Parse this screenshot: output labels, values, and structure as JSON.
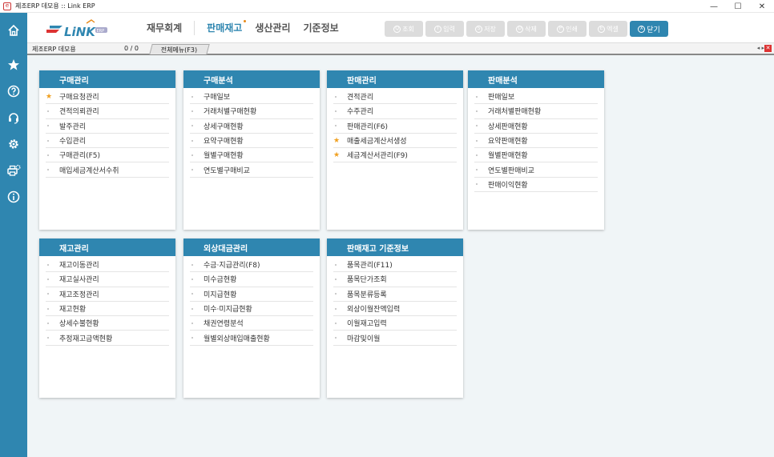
{
  "window": {
    "title": "제조ERP 데모용 :: Link ERP",
    "controls": [
      "—",
      "☐",
      "✕"
    ]
  },
  "logo": {
    "text": "LiNK",
    "badge": "ERP"
  },
  "topnav": [
    {
      "label": "재무회계",
      "active": false
    },
    {
      "label": "판매재고",
      "active": true
    },
    {
      "label": "생산관리",
      "active": false
    },
    {
      "label": "기준정보",
      "active": false
    }
  ],
  "actions": [
    {
      "icon": "Q",
      "label": "조회"
    },
    {
      "icon": "I",
      "label": "입력"
    },
    {
      "icon": "S",
      "label": "저장"
    },
    {
      "icon": "D",
      "label": "삭제"
    },
    {
      "icon": "P",
      "label": "인쇄"
    },
    {
      "icon": "E",
      "label": "엑셀"
    },
    {
      "icon": "X",
      "label": "닫기"
    }
  ],
  "tabrow": {
    "label": "제조ERP 데모용",
    "count": "0 / 0",
    "tab": "전체메뉴(F3)",
    "arrows": "◂ ▸",
    "close": "✕"
  },
  "sidebar": [
    "home-icon",
    "star-icon",
    "help-icon",
    "headset-icon",
    "gear-icon",
    "printer-settings-icon",
    "info-icon"
  ],
  "cards": [
    {
      "title": "구매관리",
      "items": [
        {
          "label": "구매요청관리",
          "fav": true
        },
        {
          "label": "견적의뢰관리"
        },
        {
          "label": "발주관리"
        },
        {
          "label": "수입관리"
        },
        {
          "label": "구매관리(F5)"
        },
        {
          "label": "매입세금계산서수취"
        }
      ]
    },
    {
      "title": "구매분석",
      "items": [
        {
          "label": "구매일보"
        },
        {
          "label": "거래처별구매현황"
        },
        {
          "label": "상세구매현황"
        },
        {
          "label": "요약구매현황"
        },
        {
          "label": "월별구매현황"
        },
        {
          "label": "연도별구매비교"
        }
      ]
    },
    {
      "title": "판매관리",
      "items": [
        {
          "label": "견적관리"
        },
        {
          "label": "수주관리"
        },
        {
          "label": "판매관리(F6)"
        },
        {
          "label": "매출세금계산서생성",
          "fav": true
        },
        {
          "label": "세금계산서관리(F9)",
          "fav": true
        }
      ]
    },
    {
      "title": "판매분석",
      "items": [
        {
          "label": "판매일보"
        },
        {
          "label": "거래처별판매현황"
        },
        {
          "label": "상세판매현황"
        },
        {
          "label": "요약판매현황"
        },
        {
          "label": "월별판매현황"
        },
        {
          "label": "연도별판매비교"
        },
        {
          "label": "판매이익현황"
        }
      ]
    },
    {
      "title": "재고관리",
      "items": [
        {
          "label": "재고이동관리"
        },
        {
          "label": "재고실사관리"
        },
        {
          "label": "재고조정관리"
        },
        {
          "label": "재고현황"
        },
        {
          "label": "상세수불현황"
        },
        {
          "label": "추정재고금액현황"
        }
      ]
    },
    {
      "title": "외상대금관리",
      "items": [
        {
          "label": "수금·지급관리(F8)"
        },
        {
          "label": "미수금현황"
        },
        {
          "label": "미지급현황"
        },
        {
          "label": "미수·미지급현황"
        },
        {
          "label": "채권연령분석"
        },
        {
          "label": "월별외상매입매출현황"
        }
      ]
    },
    {
      "title": "판매재고 기준정보",
      "items": [
        {
          "label": "품목관리(F11)"
        },
        {
          "label": "품목단가조회"
        },
        {
          "label": "품목분류등록"
        },
        {
          "label": "외상이월잔액입력"
        },
        {
          "label": "이월재고입력"
        },
        {
          "label": "마감및이월"
        }
      ]
    }
  ]
}
